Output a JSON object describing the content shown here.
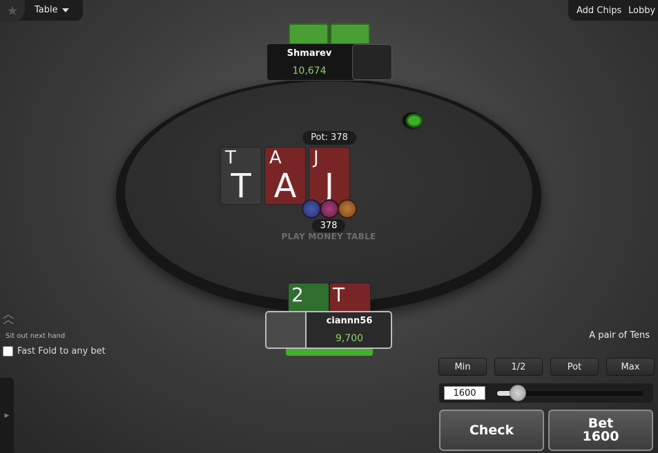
{
  "topbar": {
    "star_icon": "star-icon",
    "table_menu_label": "Table",
    "add_chips_label": "Add Chips",
    "lobby_label": "Lobby"
  },
  "opponent": {
    "name": "Shmarev",
    "stack": "10,674"
  },
  "pot": {
    "label": "Pot: 378",
    "amount": "378"
  },
  "board": [
    {
      "rank": "T",
      "color": "#3a3a3a"
    },
    {
      "rank": "A",
      "color": "#7a2525"
    },
    {
      "rank": "J",
      "color": "#7a2525"
    }
  ],
  "table_watermark": "PLAY MONEY TABLE",
  "hero": {
    "name": "ciannn56",
    "stack": "9,700",
    "cards": [
      {
        "rank": "2",
        "color": "#2f6e2f"
      },
      {
        "rank": "T",
        "color": "#7a2525"
      }
    ]
  },
  "left_controls": {
    "sit_out_label": "Sit out next hand",
    "fast_fold_label": "Fast Fold to any bet"
  },
  "hand_strength": "A pair of Tens",
  "bet_presets": [
    "Min",
    "1/2",
    "Pot",
    "Max"
  ],
  "bet_slider": {
    "input_value": "1600",
    "fraction": 0.06
  },
  "actions": {
    "check_label": "Check",
    "bet_label": "Bet",
    "bet_amount": "1600"
  },
  "colors": {
    "stack_green": "#8fd06d",
    "card_red": "#7a2525",
    "card_green": "#2f6e2f",
    "timer_green": "#42b02b"
  }
}
